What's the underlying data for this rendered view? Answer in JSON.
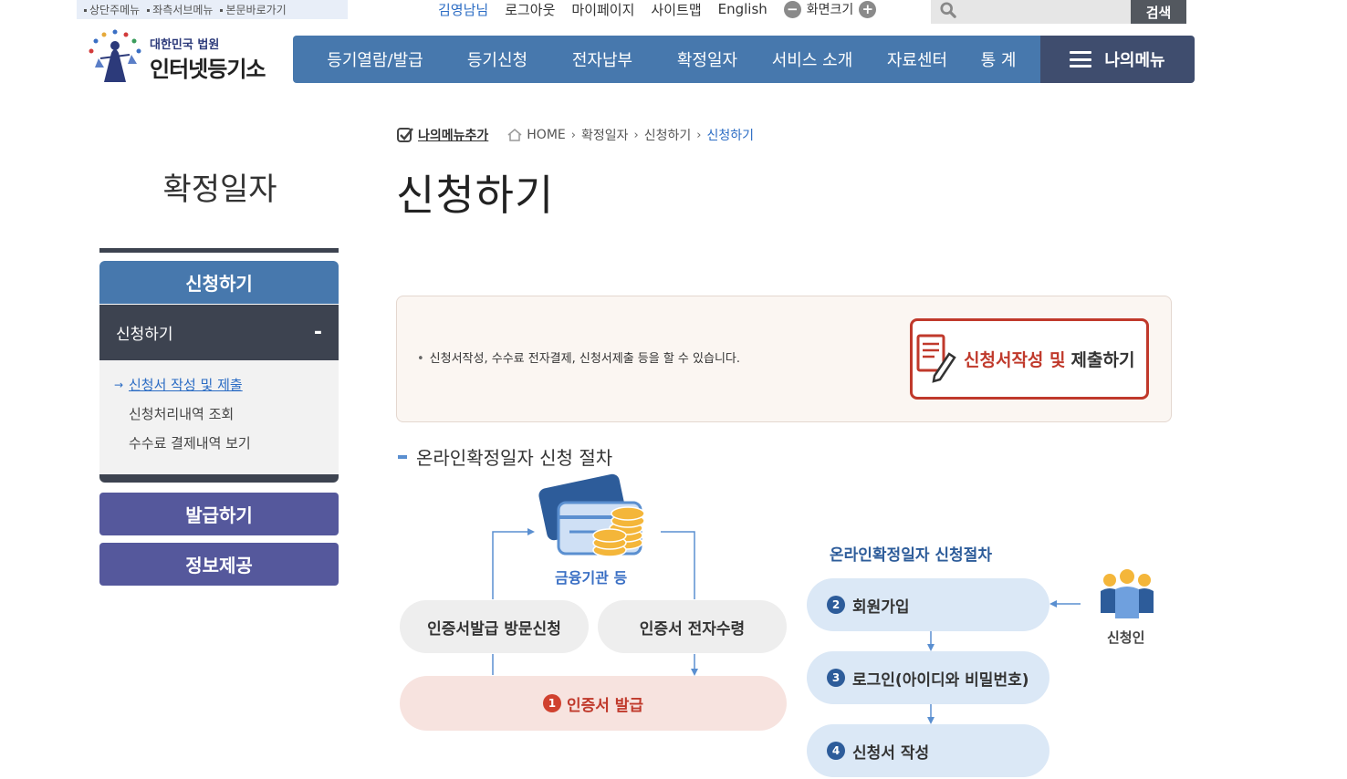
{
  "skip_links": [
    "상단주메뉴",
    "좌측서브메뉴",
    "본문바로가기"
  ],
  "util": {
    "user": "김영남님",
    "logout": "로그아웃",
    "mypage": "마이페이지",
    "sitemap": "사이트맵",
    "english": "English",
    "zoom_label": "화면크기",
    "zoom_out": "−",
    "zoom_in": "+"
  },
  "search": {
    "placeholder": "",
    "button": "검색"
  },
  "logo": {
    "line1": "대한민국 법원",
    "line2": "인터넷등기소"
  },
  "nav": [
    "등기열람/발급",
    "등기신청",
    "전자납부",
    "확정일자",
    "서비스 소개",
    "자료센터",
    "통 계"
  ],
  "mymenu": "나의메뉴",
  "sidebar": {
    "title": "확정일자",
    "section": "신청하기",
    "sub_open": "신청하기",
    "sub_icon": "-",
    "items": [
      "신청서 작성 및 제출",
      "신청처리내역 조회",
      "수수료 결제내역 보기"
    ],
    "btn2": "발급하기",
    "btn3": "정보제공"
  },
  "breadcrumb": {
    "add_menu": "나의메뉴추가",
    "home": "HOME",
    "c1": "확정일자",
    "c2": "신청하기",
    "current": "신청하기"
  },
  "page_title": "신청하기",
  "info": {
    "desc": "신청서작성, 수수료 전자결제, 신청서제출 등을 할 수 있습니다.",
    "button_a": "신청서작성 및",
    "button_b": "제출하기"
  },
  "procedure": {
    "title": "온라인확정일자 신청 절차",
    "bank": "금융기관 등",
    "visit": "인증서발급 방문신청",
    "receive": "인증서 전자수령",
    "step1": "인증서 발급",
    "right_title": "온라인확정일자 신청절차",
    "step2": "회원가입",
    "step3": "로그인(아이디와 비밀번호)",
    "step4": "신청서 작성",
    "applicant": "신청인",
    "n1": "1",
    "n2": "2",
    "n3": "3",
    "n4": "4"
  },
  "colors": {
    "nav": "#4778ad",
    "mymenu": "#3f4d6e",
    "sidebar_dark": "#3d4350",
    "side_btn": "#55589c",
    "accent_red": "#c0392b"
  }
}
